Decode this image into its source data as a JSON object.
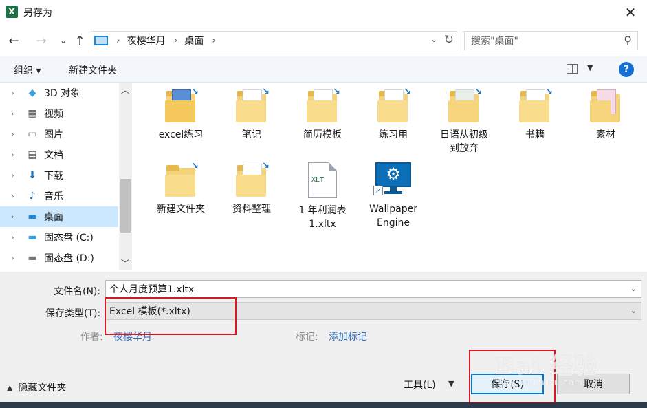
{
  "window": {
    "title": "另存为",
    "app_icon": "excel-logo-icon",
    "app_icon_letter": "X"
  },
  "nav": {
    "back_icon": "arrow-left-icon",
    "forward_icon": "arrow-right-icon",
    "recent_icon": "chevron-down-icon",
    "up_icon": "arrow-up-icon",
    "breadcrumbs": [
      "夜樱华月",
      "桌面"
    ],
    "search_placeholder": "搜索\"桌面\""
  },
  "toolbar": {
    "organize_label": "组织 ▾",
    "new_folder_label": "新建文件夹",
    "help_label": "?"
  },
  "sidebar": {
    "items": [
      {
        "label": "3D 对象",
        "icon": "3d-objects-icon"
      },
      {
        "label": "视频",
        "icon": "video-icon"
      },
      {
        "label": "图片",
        "icon": "pictures-icon"
      },
      {
        "label": "文档",
        "icon": "documents-icon"
      },
      {
        "label": "下载",
        "icon": "download-icon"
      },
      {
        "label": "音乐",
        "icon": "music-icon"
      },
      {
        "label": "桌面",
        "icon": "desktop-icon",
        "selected": true
      },
      {
        "label": "固态盘 (C:)",
        "icon": "drive-c-icon"
      },
      {
        "label": "固态盘 (D:)",
        "icon": "drive-d-icon"
      }
    ]
  },
  "files": {
    "row1": [
      {
        "label": "excel练习",
        "icon": "winrar-folder-icon"
      },
      {
        "label": "笔记",
        "icon": "folder-icon"
      },
      {
        "label": "简历模板",
        "icon": "folder-icon"
      },
      {
        "label": "练习用",
        "icon": "folder-icon"
      },
      {
        "label": "日语从初级到放弃",
        "icon": "folder-icon"
      },
      {
        "label": "书籍",
        "icon": "folder-icon"
      },
      {
        "label": "素材",
        "icon": "folder-icon"
      }
    ],
    "row2": [
      {
        "label": "新建文件夹",
        "icon": "folder-icon"
      },
      {
        "label": "资料整理",
        "icon": "folder-icon"
      },
      {
        "label": "1 年利润表1.xltx",
        "icon": "xlt-file-icon",
        "badge": "XLT"
      },
      {
        "label": "Wallpaper Engine",
        "icon": "wallpaper-engine-icon"
      }
    ]
  },
  "form": {
    "filename_label": "文件名(N):",
    "filename_value": "个人月度预算1.xltx",
    "type_label": "保存类型(T):",
    "type_value": "Excel 模板(*.xltx)",
    "author_label": "作者:",
    "author_value": "夜樱华月",
    "tags_label": "标记:",
    "tags_value": "添加标记"
  },
  "footer": {
    "hide_folders_label": "隐藏文件夹",
    "tools_label": "工具(L)",
    "save_label": "保存(S)",
    "cancel_label": "取消"
  },
  "watermark": {
    "text": "Bai 经验",
    "sub": "jingyan.baidu.com"
  },
  "colors": {
    "accent": "#0078d7",
    "selected": "#cce8ff",
    "annotation": "#d7181f",
    "link": "#2e6fbd"
  }
}
